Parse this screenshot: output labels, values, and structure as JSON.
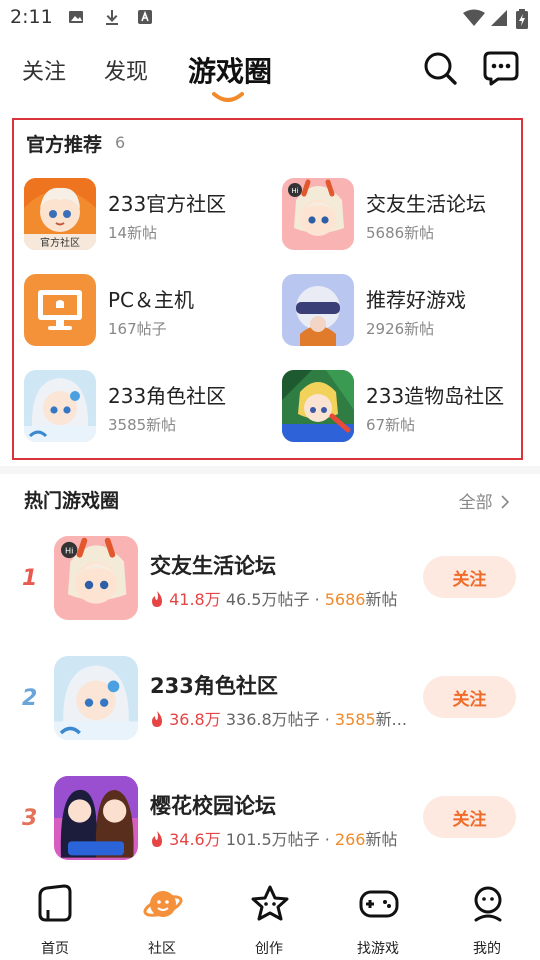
{
  "status_bar": {
    "time": "2:11"
  },
  "top_nav": {
    "tabs": [
      {
        "label": "关注"
      },
      {
        "label": "发现"
      },
      {
        "label": "游戏圈"
      }
    ],
    "accent_color": "#f08a2a"
  },
  "official": {
    "title": "官方推荐",
    "count": "6",
    "items": [
      {
        "name": "233官方社区",
        "sub": "14新帖",
        "badge": "官方社区"
      },
      {
        "name": "交友生活论坛",
        "sub": "5686新帖"
      },
      {
        "name": "PC＆主机",
        "sub": "167帖子"
      },
      {
        "name": "推荐好游戏",
        "sub": "2926新帖"
      },
      {
        "name": "233角色社区",
        "sub": "3585新帖"
      },
      {
        "name": "233造物岛社区",
        "sub": "67新帖"
      }
    ]
  },
  "hot": {
    "title": "热门游戏圈",
    "all_label": "全部",
    "follow_label": "关注",
    "rows": [
      {
        "rank": "1",
        "rank_color": "#e85a4f",
        "name": "交友生活论坛",
        "heat": "41.8万",
        "posts": "46.5万帖子",
        "new_count": "5686",
        "new_suffix": "新帖"
      },
      {
        "rank": "2",
        "rank_color": "#6aa4d8",
        "name": "233角色社区",
        "heat": "36.8万",
        "posts": "336.8万帖子",
        "new_count": "3585",
        "new_suffix": "新..."
      },
      {
        "rank": "3",
        "rank_color": "#e2735a",
        "name": "樱花校园论坛",
        "heat": "34.6万",
        "posts": "101.5万帖子",
        "new_count": "266",
        "new_suffix": "新帖"
      }
    ]
  },
  "bottom_nav": {
    "items": [
      {
        "label": "首页",
        "icon": "home-icon"
      },
      {
        "label": "社区",
        "icon": "planet-icon"
      },
      {
        "label": "创作",
        "icon": "star-icon"
      },
      {
        "label": "找游戏",
        "icon": "gamepad-icon"
      },
      {
        "label": "我的",
        "icon": "profile-icon"
      }
    ]
  }
}
